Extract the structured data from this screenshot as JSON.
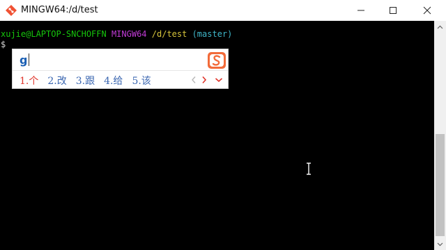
{
  "window": {
    "title": "MINGW64:/d/test",
    "app_icon": "git-bash-icon",
    "controls": {
      "minimize": "minimize-icon",
      "maximize": "maximize-icon",
      "close": "close-icon"
    }
  },
  "terminal": {
    "user_host": "xujie@LAPTOP-SNCHOFFN",
    "env": "MINGW64",
    "path": "/d/test",
    "branch": "(master)",
    "prompt_symbol": "$",
    "colors": {
      "background": "#000000",
      "user_host": "#16c60c",
      "env": "#c13bd6",
      "path": "#d6c43b",
      "branch": "#3fb6c9"
    }
  },
  "ime": {
    "input_text": "g",
    "logo": "sogou-logo-icon",
    "candidates": [
      "1.个",
      "2.改",
      "3.跟",
      "4.给",
      "5.该"
    ],
    "nav": {
      "prev": "chevron-left-icon",
      "next": "chevron-right-icon",
      "more": "chevron-down-icon"
    },
    "colors": {
      "input": "#1a5fb4",
      "first_candidate": "#e0352b",
      "candidate": "#3a66b0",
      "logo": "#f26b3a"
    }
  },
  "cursor": "ibeam-cursor-icon"
}
